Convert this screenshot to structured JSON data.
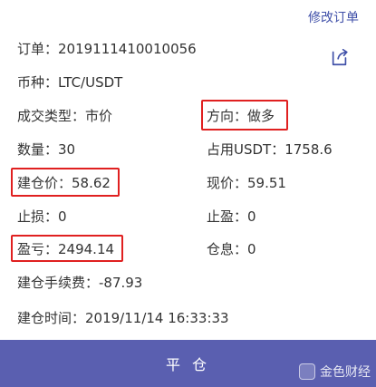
{
  "header": {
    "edit_order_label": "修改订单"
  },
  "order": {
    "order_no": "订单：2019111410010056",
    "pair": "币种：LTC/USDT",
    "trade_type": "成交类型：市价",
    "direction": "方向：做多",
    "quantity": "数量：30",
    "usdt_used": "占用USDT：1758.6",
    "open_price": "建仓价：58.62",
    "current_price": "现价：59.51",
    "stop_loss": "止损：0",
    "take_profit": "止盈：0",
    "profit_loss": "盈亏：2494.14",
    "interest": "仓息：0",
    "open_fee": "建仓手续费：-87.93",
    "open_time": "建仓时间：2019/11/14 16:33:33"
  },
  "actions": {
    "close_position_label": "平 仓"
  },
  "watermark": {
    "text": "金色财经"
  },
  "colors": {
    "accent": "#3f4fa8",
    "bar": "#5a5fb0",
    "highlight": "#e02020"
  },
  "icons": {
    "share": "share-icon"
  }
}
